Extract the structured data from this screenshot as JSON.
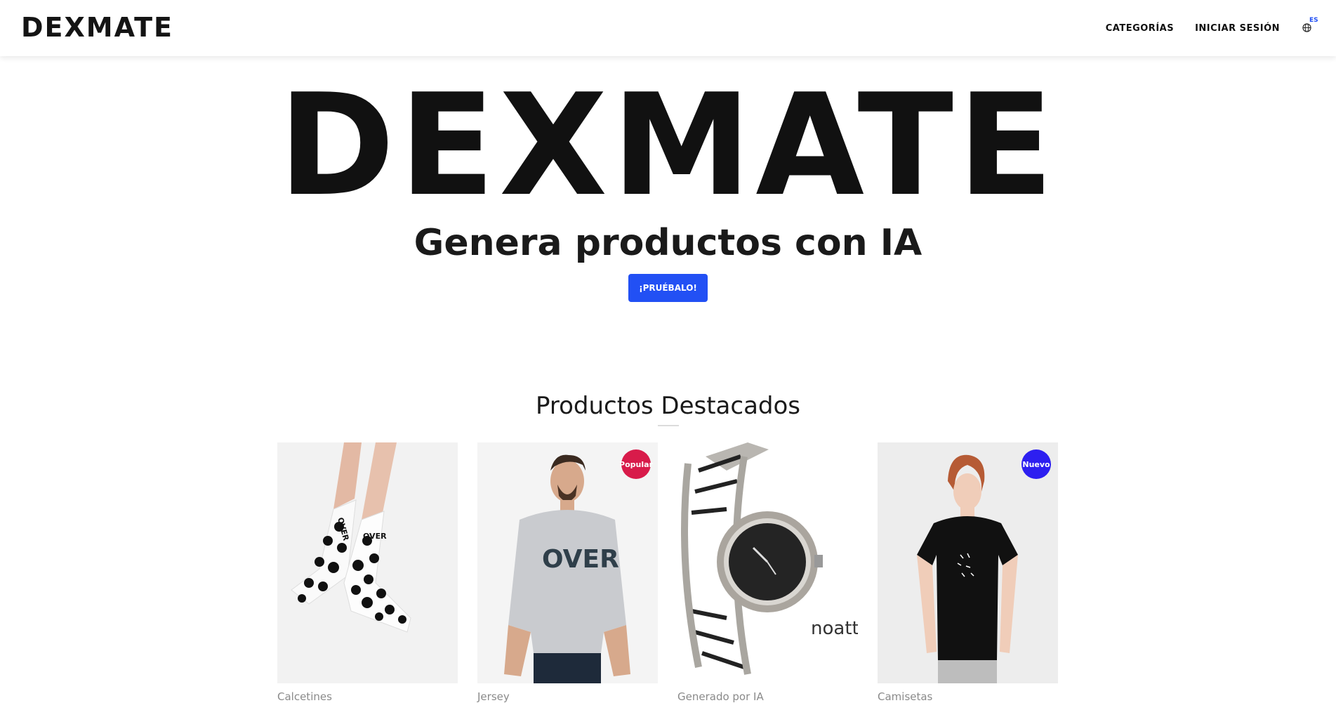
{
  "header": {
    "logo": "DEXMATE",
    "nav": {
      "categories": "CATEGORÍAS",
      "login": "INICIAR SESIÓN"
    },
    "language": {
      "code": "ES",
      "icon": "globe-icon"
    }
  },
  "hero": {
    "title": "DEXMATE",
    "subtitle": "Genera productos con IA",
    "cta": "¡PRUÉBALO!"
  },
  "featured": {
    "title": "Productos Destacados",
    "products": [
      {
        "category": "Calcetines",
        "badge": "",
        "image": "socks-image"
      },
      {
        "category": "Jersey",
        "badge": "Popular",
        "badge_color": "#d81b4a",
        "image": "sweater-image"
      },
      {
        "category": "Generado por IA",
        "badge": "",
        "image": "watch-image",
        "watermark": "noatt"
      },
      {
        "category": "Camisetas",
        "badge": "Nuevo",
        "badge_color": "#2d1ff0",
        "image": "tshirt-image"
      }
    ]
  },
  "colors": {
    "accent": "#2250f4",
    "popular": "#d81b4a",
    "new": "#2d1ff0"
  }
}
